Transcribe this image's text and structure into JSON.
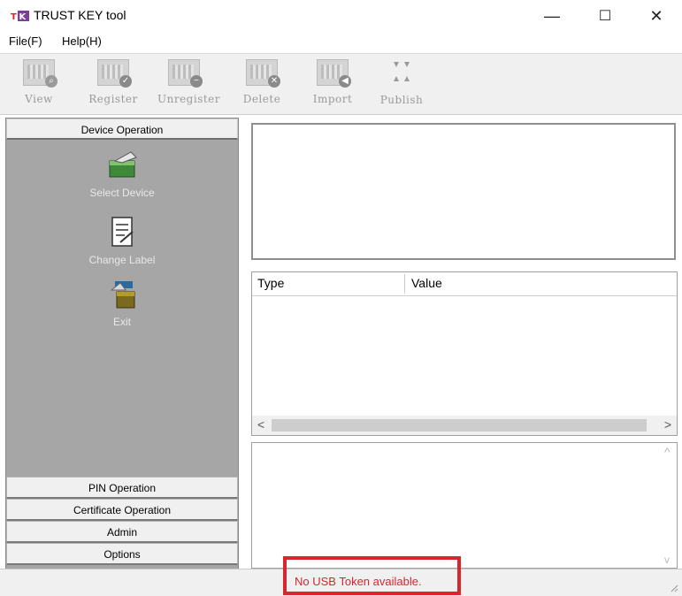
{
  "window": {
    "title": "TRUST KEY tool",
    "controls": [
      "—",
      "☐",
      "✕"
    ]
  },
  "menu": {
    "file": "File(F)",
    "help": "Help(H)"
  },
  "toolbar": {
    "view": "View",
    "register": "Register",
    "unregister": "Unregister",
    "delete": "Delete",
    "import": "Import",
    "publish": "Publish"
  },
  "left_panel": {
    "header": "Device Operation",
    "items": [
      {
        "label": "Select Device",
        "icon": "select-device-icon"
      },
      {
        "label": "Change Label",
        "icon": "change-label-icon"
      },
      {
        "label": "Exit",
        "icon": "exit-icon"
      }
    ],
    "sections": [
      "PIN Operation",
      "Certificate Operation",
      "Admin",
      "Options"
    ]
  },
  "grid": {
    "columns": [
      "Type",
      "Value"
    ],
    "scroll_left": "<",
    "scroll_right": ">"
  },
  "log": {
    "scroll_up": "^",
    "scroll_down": "v"
  },
  "status": {
    "message": "No USB Token available."
  },
  "colors": {
    "status_red": "#d7262e",
    "panel_gray": "#a6a6a6",
    "logo_purple": "#7b3f98"
  }
}
